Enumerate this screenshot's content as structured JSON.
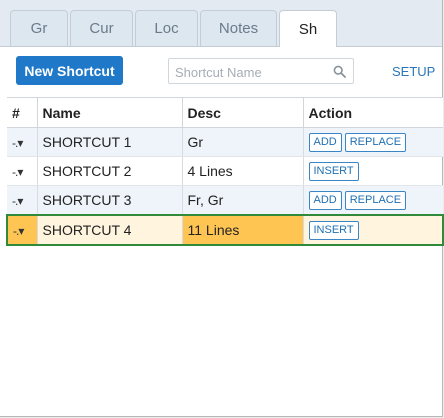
{
  "tabs": [
    {
      "label": "Gr"
    },
    {
      "label": "Cur"
    },
    {
      "label": "Loc"
    },
    {
      "label": "Notes"
    },
    {
      "label": "Sh",
      "active": true
    }
  ],
  "toolbar": {
    "new_label": "New Shortcut",
    "search_placeholder": "Shortcut Name",
    "setup_label": "SETUP"
  },
  "table": {
    "headers": [
      "#",
      "Name",
      "Desc",
      "Action"
    ],
    "rows": [
      {
        "handle": "-.▾",
        "name": "SHORTCUT 1",
        "desc": "Gr",
        "actions": [
          "ADD",
          "REPLACE"
        ]
      },
      {
        "handle": "-.▾",
        "name": "SHORTCUT 2",
        "desc": "4 Lines",
        "actions": [
          "INSERT"
        ]
      },
      {
        "handle": "-.▾",
        "name": "SHORTCUT 3",
        "desc": "Fr, Gr",
        "actions": [
          "ADD",
          "REPLACE"
        ]
      },
      {
        "handle": "-.▾",
        "name": "SHORTCUT 4",
        "desc": "11 Lines",
        "actions": [
          "INSERT"
        ],
        "selected": true
      }
    ]
  },
  "colors": {
    "accent": "#1f78c8",
    "selected_row": "#ffc552",
    "selected_border": "#2f8a3c"
  }
}
